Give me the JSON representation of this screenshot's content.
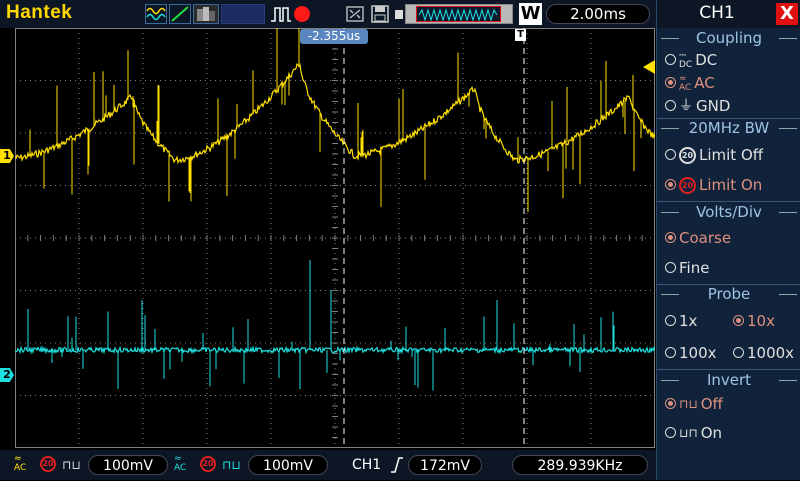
{
  "topbar": {
    "brand": "Hantek",
    "mode_w": "W",
    "timebase": "2.00ms"
  },
  "scope": {
    "trigger_position": "-2.355us",
    "trigger_marker_letter": "T",
    "ch1_marker": "1",
    "ch2_marker": "2",
    "colors": {
      "ch1": "#ffe000",
      "ch2": "#1ee0e0",
      "grid": "#808080"
    }
  },
  "bottombar": {
    "ch1_volts": "100mV",
    "ch2_volts": "100mV",
    "bw_badge": "20",
    "trigger_source": "CH1",
    "trigger_level": "172mV",
    "frequency": "289.939KHz"
  },
  "panel": {
    "title": "CH1",
    "close": "X",
    "coupling": {
      "title": "Coupling",
      "options": [
        {
          "label": "DC",
          "icon": "dc-coupling-icon",
          "selected": false
        },
        {
          "label": "AC",
          "icon": "ac-coupling-icon",
          "selected": true
        },
        {
          "label": "GND",
          "icon": "ground-icon",
          "selected": false
        }
      ]
    },
    "bandwidth": {
      "title": "20MHz BW",
      "badge": "20",
      "options": [
        {
          "label": "Limit Off",
          "selected": false
        },
        {
          "label": "Limit On",
          "selected": true
        }
      ]
    },
    "volts_div": {
      "title": "Volts/Div",
      "options": [
        {
          "label": "Coarse",
          "selected": true
        },
        {
          "label": "Fine",
          "selected": false
        }
      ]
    },
    "probe": {
      "title": "Probe",
      "options": [
        {
          "label": "1x",
          "selected": false
        },
        {
          "label": "10x",
          "selected": true
        },
        {
          "label": "100x",
          "selected": false
        },
        {
          "label": "1000x",
          "selected": false
        }
      ]
    },
    "invert": {
      "title": "Invert",
      "options": [
        {
          "label": "Off",
          "selected": true
        },
        {
          "label": "On",
          "selected": false
        }
      ]
    }
  }
}
